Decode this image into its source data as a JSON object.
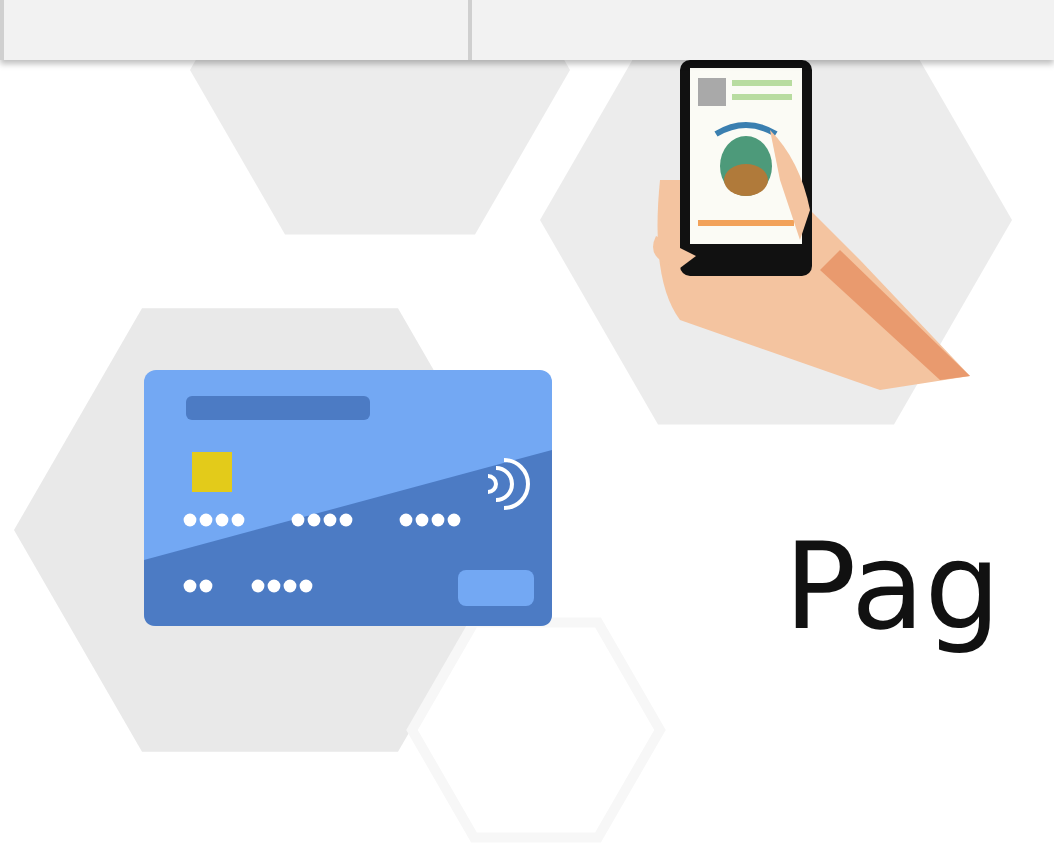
{
  "hero": {
    "heading": "Pag"
  }
}
